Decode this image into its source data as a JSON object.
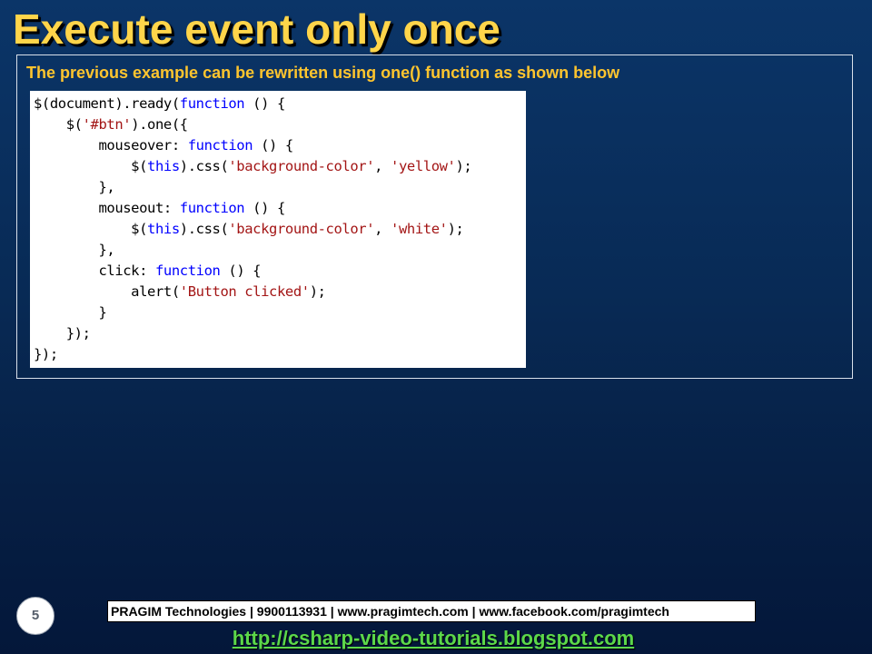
{
  "slide": {
    "title": "Execute event only once",
    "intro": "The previous example can be rewritten using one() function as shown below",
    "number": "5"
  },
  "code": {
    "language": "javascript",
    "lines": [
      [
        {
          "t": "p",
          "v": "$(document).ready("
        },
        {
          "t": "kw",
          "v": "function"
        },
        {
          "t": "p",
          "v": " () {"
        }
      ],
      [
        {
          "t": "p",
          "v": "    $("
        },
        {
          "t": "str",
          "v": "'#btn'"
        },
        {
          "t": "p",
          "v": ").one({"
        }
      ],
      [
        {
          "t": "p",
          "v": "        mouseover: "
        },
        {
          "t": "kw",
          "v": "function"
        },
        {
          "t": "p",
          "v": " () {"
        }
      ],
      [
        {
          "t": "p",
          "v": "            $("
        },
        {
          "t": "kw",
          "v": "this"
        },
        {
          "t": "p",
          "v": ").css("
        },
        {
          "t": "str",
          "v": "'background-color'"
        },
        {
          "t": "p",
          "v": ", "
        },
        {
          "t": "str",
          "v": "'yellow'"
        },
        {
          "t": "p",
          "v": ");"
        }
      ],
      [
        {
          "t": "p",
          "v": "        },"
        }
      ],
      [
        {
          "t": "p",
          "v": "        mouseout: "
        },
        {
          "t": "kw",
          "v": "function"
        },
        {
          "t": "p",
          "v": " () {"
        }
      ],
      [
        {
          "t": "p",
          "v": "            $("
        },
        {
          "t": "kw",
          "v": "this"
        },
        {
          "t": "p",
          "v": ").css("
        },
        {
          "t": "str",
          "v": "'background-color'"
        },
        {
          "t": "p",
          "v": ", "
        },
        {
          "t": "str",
          "v": "'white'"
        },
        {
          "t": "p",
          "v": ");"
        }
      ],
      [
        {
          "t": "p",
          "v": "        },"
        }
      ],
      [
        {
          "t": "p",
          "v": "        click: "
        },
        {
          "t": "kw",
          "v": "function"
        },
        {
          "t": "p",
          "v": " () {"
        }
      ],
      [
        {
          "t": "p",
          "v": "            alert("
        },
        {
          "t": "str",
          "v": "'Button clicked'"
        },
        {
          "t": "p",
          "v": ");"
        }
      ],
      [
        {
          "t": "p",
          "v": "        }"
        }
      ],
      [
        {
          "t": "p",
          "v": "    });"
        }
      ],
      [
        {
          "t": "p",
          "v": "});"
        }
      ]
    ]
  },
  "footer": {
    "company_info": "PRAGIM Technologies | 9900113931 | www.pragimtech.com | www.facebook.com/pragimtech",
    "blog_url": "http://csharp-video-tutorials.blogspot.com"
  },
  "colors": {
    "title": "#ffd54a",
    "intro": "#ffc52e",
    "keyword": "#0000ff",
    "string": "#a31515",
    "link": "#5cd84a",
    "background": "#0b3568"
  }
}
